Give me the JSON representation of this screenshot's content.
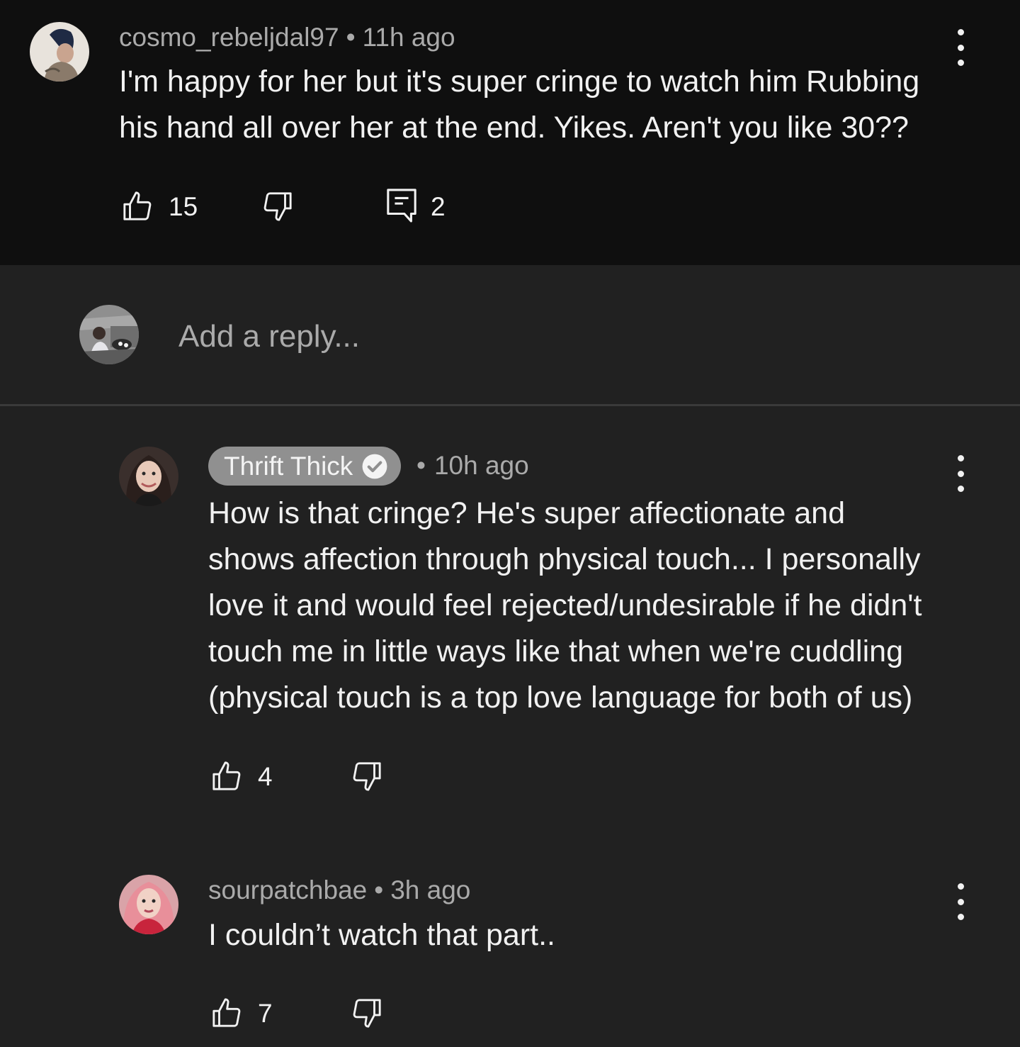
{
  "top_comment": {
    "author": "cosmo_rebeljdal97",
    "separator": "•",
    "time": "11h ago",
    "text_line1": "I'm happy for her but it's super cringe to watch him Rubbing",
    "text_line2": "his hand all over her at the end. Yikes. Aren't you like 30??",
    "likes": "15",
    "replies": "2"
  },
  "reply_box": {
    "placeholder": "Add a reply..."
  },
  "replies": [
    {
      "author": "Thrift Thick",
      "is_creator": true,
      "separator": "•",
      "time": "10h ago",
      "lines": [
        "How is that cringe? He's super affectionate and",
        "shows affection through physical touch... I personally",
        "love it and would feel rejected/undesirable if he didn't",
        "touch me in little ways like that when we're cuddling",
        "(physical touch is a top love language for both of us)"
      ],
      "likes": "4"
    },
    {
      "author": "sourpatchbae",
      "separator": "•",
      "time": "3h ago",
      "text": "I couldn’t watch that part..",
      "likes": "7"
    }
  ],
  "icons": {
    "like": "thumbs-up-icon",
    "dislike": "thumbs-down-icon",
    "reply": "comment-icon",
    "more": "more-vert-icon",
    "verified": "check-circle-icon"
  },
  "colors": {
    "background_top": "#0f0f0f",
    "background": "#212121",
    "text_primary": "#f1f1f1",
    "text_secondary": "#aaaaaa",
    "creator_chip": "#909090"
  }
}
